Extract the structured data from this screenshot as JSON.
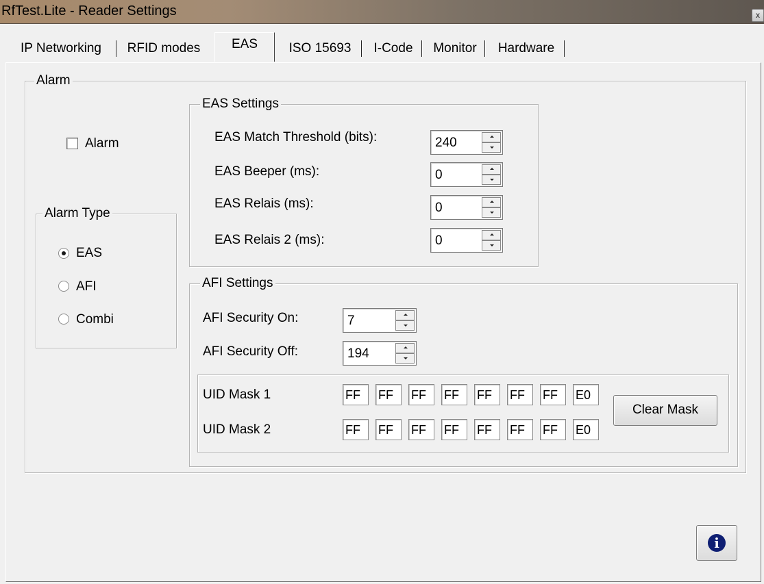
{
  "window": {
    "title": "RfTest.Lite - Reader Settings",
    "close_glyph": "x"
  },
  "tabs": [
    {
      "label": "IP Networking"
    },
    {
      "label": "RFID modes"
    },
    {
      "label": "EAS",
      "active": true
    },
    {
      "label": "ISO 15693"
    },
    {
      "label": "I-Code"
    },
    {
      "label": "Monitor"
    },
    {
      "label": "Hardware"
    }
  ],
  "alarm": {
    "group_label": "Alarm",
    "checkbox_label": "Alarm",
    "checked": false,
    "alarm_type": {
      "group_label": "Alarm Type",
      "options": [
        "EAS",
        "AFI",
        "Combi"
      ],
      "selected": "EAS"
    }
  },
  "eas_settings": {
    "group_label": "EAS Settings",
    "fields": [
      {
        "label": "EAS Match Threshold (bits):",
        "value": "240"
      },
      {
        "label": "EAS Beeper (ms):",
        "value": "0"
      },
      {
        "label": "EAS Relais (ms):",
        "value": "0"
      },
      {
        "label": "EAS Relais 2 (ms):",
        "value": "0"
      }
    ]
  },
  "afi_settings": {
    "group_label": "AFI Settings",
    "security_on": {
      "label": "AFI Security On:",
      "value": "7"
    },
    "security_off": {
      "label": "AFI Security Off:",
      "value": "194"
    },
    "uid_mask_1": {
      "label": "UID Mask 1",
      "bytes": [
        "FF",
        "FF",
        "FF",
        "FF",
        "FF",
        "FF",
        "FF",
        "E0"
      ]
    },
    "uid_mask_2": {
      "label": "UID Mask 2",
      "bytes": [
        "FF",
        "FF",
        "FF",
        "FF",
        "FF",
        "FF",
        "FF",
        "E0"
      ]
    },
    "clear_mask_label": "Clear Mask"
  },
  "info_button": {
    "icon": "info-icon",
    "glyph": "i"
  }
}
